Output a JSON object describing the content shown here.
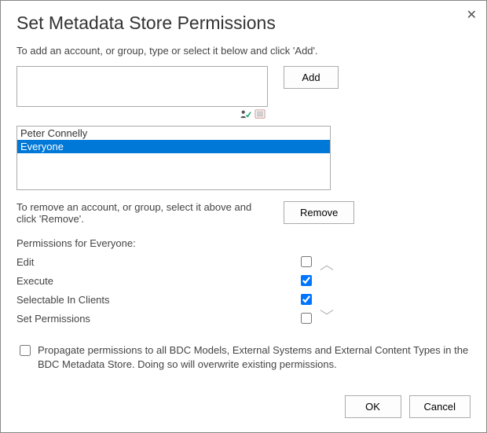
{
  "dialog": {
    "title": "Set Metadata Store Permissions",
    "add_instruction": "To add an account, or group, type or select it below and click 'Add'.",
    "add_button": "Add",
    "remove_instruction": "To remove an account, or group, select it above and click 'Remove'.",
    "remove_button": "Remove",
    "permissions_label": "Permissions for Everyone:",
    "propagate_label": "Propagate permissions to all BDC Models, External Systems and External Content Types in the BDC Metadata Store. Doing so will overwrite existing permissions.",
    "ok_button": "OK",
    "cancel_button": "Cancel"
  },
  "accounts": [
    {
      "name": "Peter Connelly",
      "selected": false
    },
    {
      "name": "Everyone",
      "selected": true
    }
  ],
  "permissions": [
    {
      "label": "Edit",
      "checked": false
    },
    {
      "label": "Execute",
      "checked": true
    },
    {
      "label": "Selectable In Clients",
      "checked": true
    },
    {
      "label": "Set Permissions",
      "checked": false
    }
  ],
  "propagate_checked": false
}
